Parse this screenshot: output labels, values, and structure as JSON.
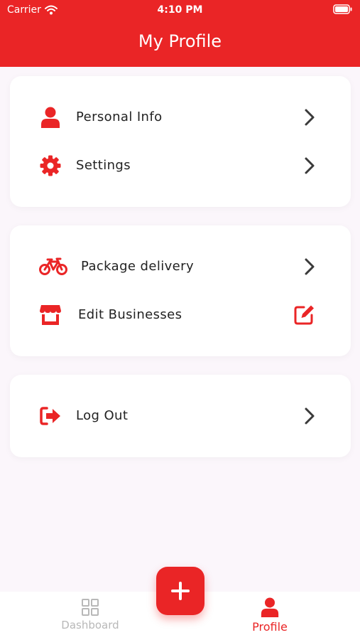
{
  "status_bar": {
    "carrier": "Carrier",
    "time": "4:10 PM"
  },
  "header": {
    "title": "My Profile"
  },
  "cards": {
    "account": {
      "personal_info": "Personal Info",
      "settings": "Settings"
    },
    "business": {
      "package_delivery": "Package delivery",
      "edit_businesses": "Edit Businesses"
    },
    "session": {
      "log_out": "Log Out"
    }
  },
  "tabs": {
    "dashboard": "Dashboard",
    "profile": "Profile"
  },
  "colors": {
    "accent": "#ea2526",
    "inactive_tab": "#b8b8b8",
    "chevron": "#3a3a3a"
  }
}
